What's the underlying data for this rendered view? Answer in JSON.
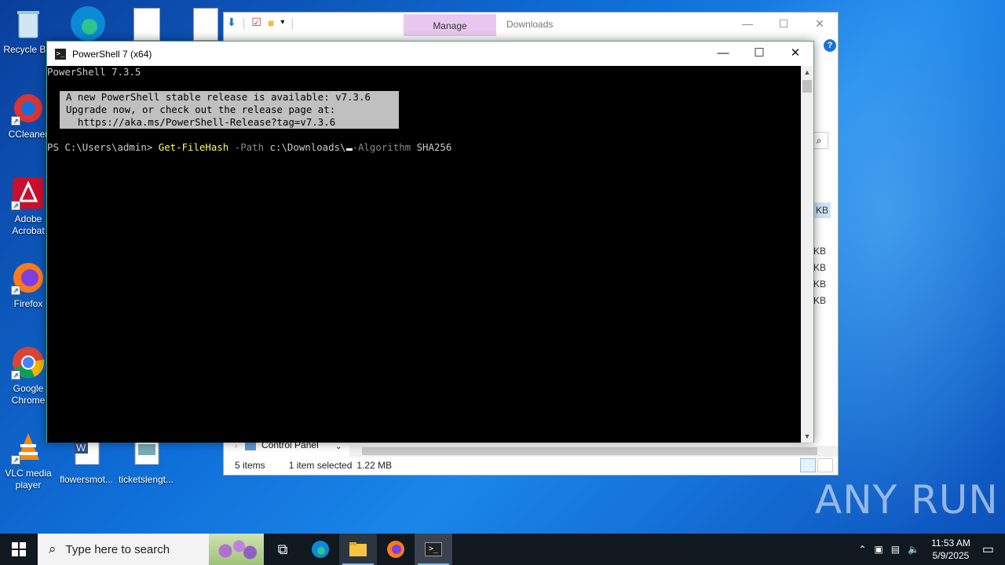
{
  "desktop": {
    "icons": [
      {
        "label": "Recycle Bin",
        "icon": "recycle-bin-icon"
      },
      {
        "label": "CCleaner",
        "icon": "ccleaner-icon"
      },
      {
        "label": "Adobe Acrobat",
        "icon": "acrobat-icon"
      },
      {
        "label": "Firefox",
        "icon": "firefox-icon"
      },
      {
        "label": "Google Chrome",
        "icon": "chrome-icon"
      },
      {
        "label": "VLC media player",
        "icon": "vlc-icon"
      },
      {
        "label": "flowersmot...",
        "icon": "word-doc-icon"
      },
      {
        "label": "ticketslengt...",
        "icon": "image-file-icon"
      }
    ]
  },
  "explorer": {
    "manage_tab": "Manage",
    "title": "Downloads",
    "nav_item": "Control Panel",
    "status": {
      "items": "5 items",
      "selected": "1 item selected",
      "size": "1.22 MB"
    },
    "size_suffix": "KB"
  },
  "powershell": {
    "title": "PowerShell 7 (x64)",
    "version_line": "PowerShell 7.3.5",
    "notice": [
      "A new PowerShell stable release is available: v7.3.6",
      "Upgrade now, or check out the release page at:",
      "  https://aka.ms/PowerShell-Release?tag=v7.3.6"
    ],
    "prompt": "PS C:\\Users\\admin> ",
    "command": "Get-FileHash",
    "param1": "-Path",
    "arg1": "c:\\Downloads\\",
    "param2": "-Algorithm",
    "arg2": "SHA256"
  },
  "watermark": "ANY  RUN",
  "taskbar": {
    "search_placeholder": "Type here to search",
    "clock_time": "11:53 AM",
    "clock_date": "5/9/2025"
  }
}
